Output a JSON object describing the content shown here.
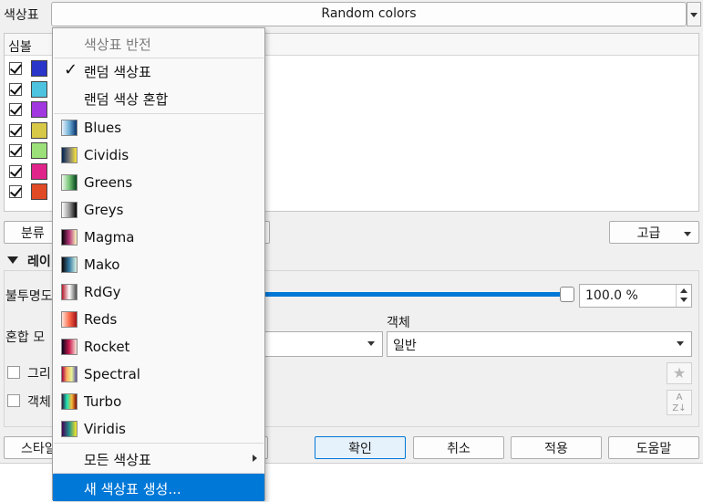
{
  "colors": {
    "accent": "#0078d7",
    "menu_highlight": "#0078d7"
  },
  "color_ramp": {
    "label": "색상표",
    "value": "Random colors"
  },
  "symbol_column_header": "심볼",
  "symbols": [
    {
      "checked": true,
      "color": "#2a35c9"
    },
    {
      "checked": true,
      "color": "#4dc3e0"
    },
    {
      "checked": true,
      "color": "#a238e0"
    },
    {
      "checked": true,
      "color": "#d8c848"
    },
    {
      "checked": true,
      "color": "#9ce07a"
    },
    {
      "checked": true,
      "color": "#e0248a"
    },
    {
      "checked": true,
      "color": "#e04a24"
    }
  ],
  "classify_button_label": "분류",
  "advanced_button_label": "고급",
  "layer_rendering_label": "레이",
  "opacity": {
    "label": "불투명도",
    "value": "100.0 %",
    "fraction": 1.0
  },
  "blend": {
    "label": "혼합 모",
    "object_label": "객체",
    "object_value": "일반"
  },
  "draw_effects_label": "그리",
  "object_label2": "객체",
  "footer": {
    "style_label": "스타일",
    "ok_label": "확인",
    "cancel_label": "취소",
    "apply_label": "적용",
    "help_label": "도움말"
  },
  "menu": {
    "invert_label": "색상표 반전",
    "random_label": "랜덤 색상표",
    "random_checked": true,
    "shuffle_label": "랜덤 색상 혼합",
    "ramps": [
      {
        "name": "Blues",
        "colors": [
          "#e8f1fb",
          "#6aaed6",
          "#08306b"
        ]
      },
      {
        "name": "Cividis",
        "colors": [
          "#00224e",
          "#7c7b78",
          "#fee838"
        ]
      },
      {
        "name": "Greens",
        "colors": [
          "#f0f9ec",
          "#74c476",
          "#00441b"
        ]
      },
      {
        "name": "Greys",
        "colors": [
          "#ffffff",
          "#969696",
          "#000000"
        ]
      },
      {
        "name": "Magma",
        "colors": [
          "#000004",
          "#b53679",
          "#fcfdbf"
        ]
      },
      {
        "name": "Mako",
        "colors": [
          "#0b0405",
          "#357ba3",
          "#def5e5"
        ]
      },
      {
        "name": "RdGy",
        "colors": [
          "#b2182b",
          "#ffffff",
          "#4d4d4d"
        ]
      },
      {
        "name": "Reds",
        "colors": [
          "#fee5d9",
          "#fb6a4a",
          "#a50f15"
        ]
      },
      {
        "name": "Rocket",
        "colors": [
          "#03051a",
          "#cb1b4f",
          "#faebdd"
        ]
      },
      {
        "name": "Spectral",
        "colors": [
          "#9e0142",
          "#fdae61",
          "#e6f598",
          "#5e4fa2"
        ]
      },
      {
        "name": "Turbo",
        "colors": [
          "#30123b",
          "#1ae4b6",
          "#faba39",
          "#7a0403"
        ]
      },
      {
        "name": "Viridis",
        "colors": [
          "#440154",
          "#21918c",
          "#fde725"
        ]
      }
    ],
    "all_ramps_label": "모든 색상표",
    "create_label": "새 색상표 생성..."
  }
}
